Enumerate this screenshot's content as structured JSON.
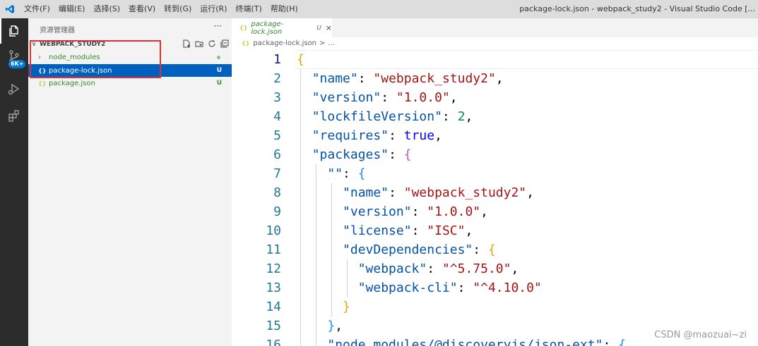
{
  "titlebar": {
    "menu": [
      "文件(F)",
      "编辑(E)",
      "选择(S)",
      "查看(V)",
      "转到(G)",
      "运行(R)",
      "终端(T)",
      "帮助(H)"
    ],
    "window_title": "package-lock.json - webpack_study2 - Visual Studio Code [..."
  },
  "activity_bar": {
    "items": [
      "explorer-icon",
      "source-control-icon",
      "run-debug-icon",
      "extensions-icon"
    ],
    "source_control_badge": "6K+"
  },
  "sidebar": {
    "header": "资源管理器",
    "more": "···",
    "section_title": "WEBPACK_STUDY2",
    "tree": [
      {
        "label": "node_modules",
        "type": "folder",
        "status": ""
      },
      {
        "label": "package-lock.json",
        "type": "json",
        "status": "U",
        "selected": true
      },
      {
        "label": "package.json",
        "type": "json",
        "status": "U"
      }
    ],
    "json_icon": "{}"
  },
  "editor": {
    "tab": {
      "label": "package-lock.json",
      "status": "U",
      "close": "×",
      "icon": "{}"
    },
    "breadcrumb": {
      "file": "package-lock.json",
      "sep": ">",
      "more": "..."
    },
    "lines": [
      {
        "n": "1",
        "tokens": [
          [
            "b1",
            "{"
          ]
        ]
      },
      {
        "n": "2",
        "tokens": [
          [
            "p",
            "  "
          ],
          [
            "key",
            "\"name\""
          ],
          [
            "p",
            ": "
          ],
          [
            "str",
            "\"webpack_study2\""
          ],
          [
            "p",
            ","
          ]
        ]
      },
      {
        "n": "3",
        "tokens": [
          [
            "p",
            "  "
          ],
          [
            "key",
            "\"version\""
          ],
          [
            "p",
            ": "
          ],
          [
            "str",
            "\"1.0.0\""
          ],
          [
            "p",
            ","
          ]
        ]
      },
      {
        "n": "4",
        "tokens": [
          [
            "p",
            "  "
          ],
          [
            "key",
            "\"lockfileVersion\""
          ],
          [
            "p",
            ": "
          ],
          [
            "num",
            "2"
          ],
          [
            "p",
            ","
          ]
        ]
      },
      {
        "n": "5",
        "tokens": [
          [
            "p",
            "  "
          ],
          [
            "key",
            "\"requires\""
          ],
          [
            "p",
            ": "
          ],
          [
            "kw",
            "true"
          ],
          [
            "p",
            ","
          ]
        ]
      },
      {
        "n": "6",
        "tokens": [
          [
            "p",
            "  "
          ],
          [
            "key",
            "\"packages\""
          ],
          [
            "p",
            ": "
          ],
          [
            "b2",
            "{"
          ]
        ]
      },
      {
        "n": "7",
        "tokens": [
          [
            "p",
            "    "
          ],
          [
            "key",
            "\"\""
          ],
          [
            "p",
            ": "
          ],
          [
            "b3",
            "{"
          ]
        ]
      },
      {
        "n": "8",
        "tokens": [
          [
            "p",
            "      "
          ],
          [
            "key",
            "\"name\""
          ],
          [
            "p",
            ": "
          ],
          [
            "str",
            "\"webpack_study2\""
          ],
          [
            "p",
            ","
          ]
        ]
      },
      {
        "n": "9",
        "tokens": [
          [
            "p",
            "      "
          ],
          [
            "key",
            "\"version\""
          ],
          [
            "p",
            ": "
          ],
          [
            "str",
            "\"1.0.0\""
          ],
          [
            "p",
            ","
          ]
        ]
      },
      {
        "n": "10",
        "tokens": [
          [
            "p",
            "      "
          ],
          [
            "key",
            "\"license\""
          ],
          [
            "p",
            ": "
          ],
          [
            "str",
            "\"ISC\""
          ],
          [
            "p",
            ","
          ]
        ]
      },
      {
        "n": "11",
        "tokens": [
          [
            "p",
            "      "
          ],
          [
            "key",
            "\"devDependencies\""
          ],
          [
            "p",
            ": "
          ],
          [
            "b1",
            "{"
          ]
        ]
      },
      {
        "n": "12",
        "tokens": [
          [
            "p",
            "        "
          ],
          [
            "key",
            "\"webpack\""
          ],
          [
            "p",
            ": "
          ],
          [
            "str",
            "\"^5.75.0\""
          ],
          [
            "p",
            ","
          ]
        ]
      },
      {
        "n": "13",
        "tokens": [
          [
            "p",
            "        "
          ],
          [
            "key",
            "\"webpack-cli\""
          ],
          [
            "p",
            ": "
          ],
          [
            "str",
            "\"^4.10.0\""
          ]
        ]
      },
      {
        "n": "14",
        "tokens": [
          [
            "p",
            "      "
          ],
          [
            "b1",
            "}"
          ]
        ]
      },
      {
        "n": "15",
        "tokens": [
          [
            "p",
            "    "
          ],
          [
            "b3",
            "}"
          ],
          [
            "p",
            ","
          ]
        ]
      },
      {
        "n": "16",
        "tokens": [
          [
            "p",
            "    "
          ],
          [
            "key",
            "\"node_modules/@discoveryjs/json-ext\""
          ],
          [
            "p",
            ": "
          ],
          [
            "b3",
            "{"
          ]
        ]
      }
    ]
  },
  "watermark": "CSDN @maozuai~zi",
  "colors": {
    "activity_bar": "#2c2c2c",
    "selection": "#0060c0",
    "untracked": "#388a34",
    "highlight_box": "#e03131",
    "json_key": "#0451a5",
    "json_string": "#a31515"
  }
}
